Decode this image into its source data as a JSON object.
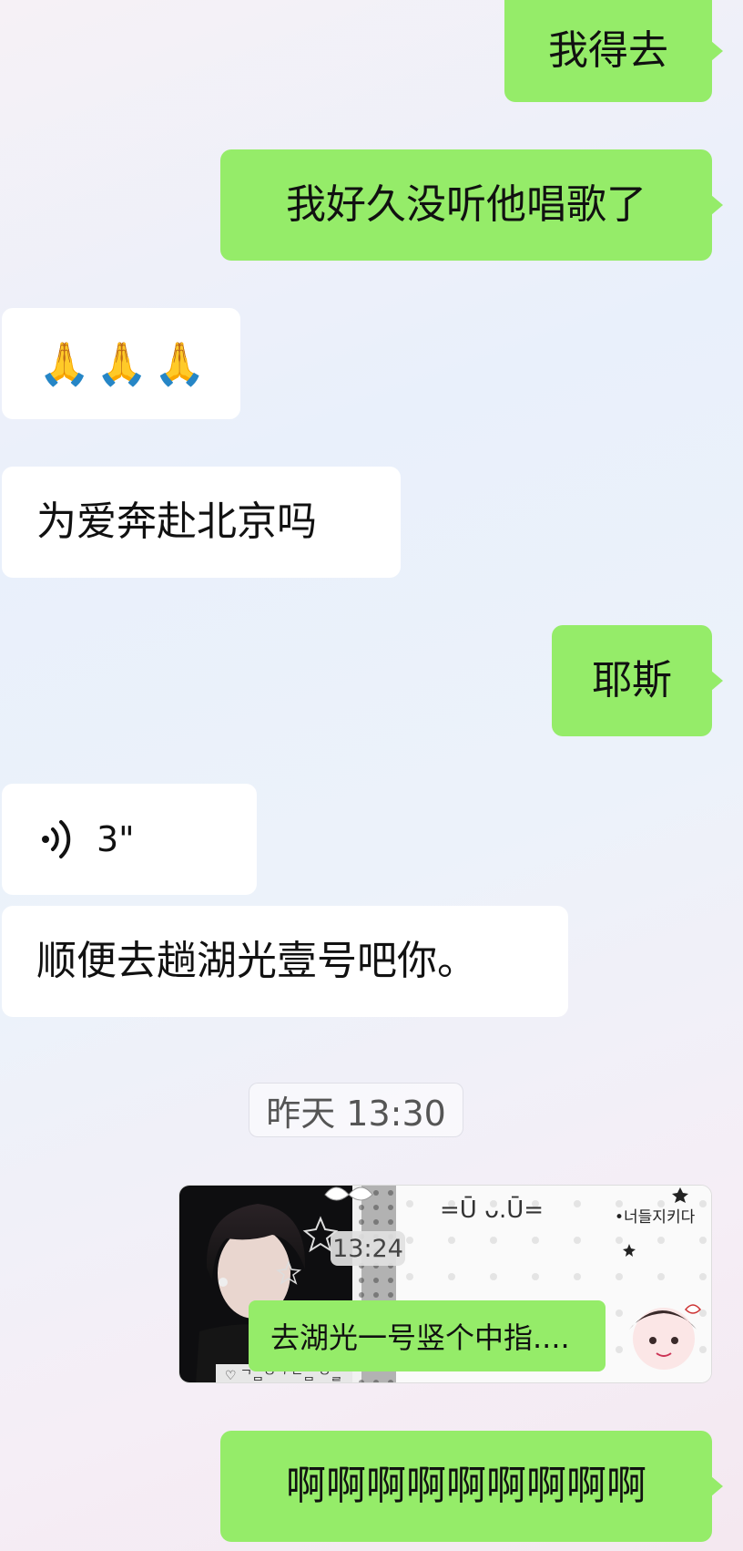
{
  "messages": {
    "m1": {
      "sender": "me",
      "text": "我得去"
    },
    "m2": {
      "sender": "me",
      "text": "我好久没听他唱歌了"
    },
    "m3": {
      "sender": "other",
      "text": "🙏🙏🙏"
    },
    "m4": {
      "sender": "other",
      "text": "为爱奔赴北京吗"
    },
    "m5": {
      "sender": "me",
      "text": "耶斯"
    },
    "m6": {
      "sender": "other",
      "type": "voice",
      "duration": "3\""
    },
    "m7": {
      "sender": "other",
      "text": "顺便去趟湖光壹号吧你。"
    },
    "m8": {
      "sender": "me",
      "type": "image",
      "inner_time": "13:24",
      "caption": "去湖光一号竖个中指....",
      "sticker_text_top": "=Ū ᴗ.Ū=",
      "sticker_text_korean": "•너들지키다"
    },
    "m9": {
      "sender": "me",
      "text": "啊啊啊啊啊啊啊啊啊"
    }
  },
  "timestamp": "昨天 13:30",
  "colors": {
    "outgoing_bubble": "#95ec69",
    "incoming_bubble": "#ffffff"
  }
}
